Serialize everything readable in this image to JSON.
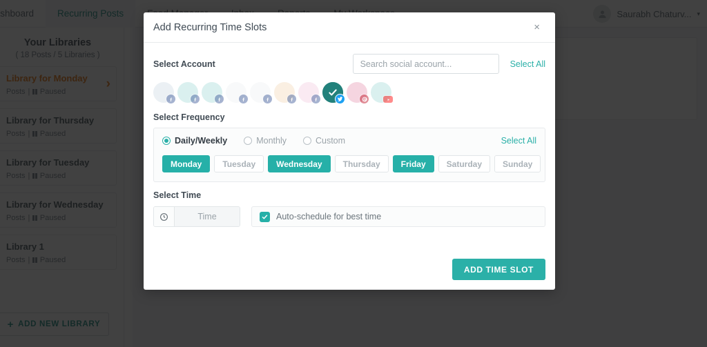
{
  "topnav": {
    "items": [
      {
        "label": "Dashboard",
        "active": false
      },
      {
        "label": "Recurring Posts",
        "active": true
      },
      {
        "label": "Feed Manager",
        "active": false
      },
      {
        "label": "Inbox",
        "active": false
      },
      {
        "label": "Reports",
        "active": false
      },
      {
        "label": "My Workspace",
        "active": false,
        "caret": "▾"
      }
    ],
    "user": {
      "name": "Saurabh Chaturv...",
      "caret": "▾",
      "avatar_icon": "user-avatar-icon"
    }
  },
  "sidebar": {
    "title": "Your Libraries",
    "subtitle": "( 18 Posts / 5 Libraries )",
    "libraries": [
      {
        "name": "Library for Monday",
        "meta": "Posts",
        "status": "Paused",
        "highlight": true
      },
      {
        "name": "Library for Thursday",
        "meta": "Posts",
        "status": "Paused",
        "highlight": false
      },
      {
        "name": "Library for Tuesday",
        "meta": "Posts",
        "status": "Paused",
        "highlight": false
      },
      {
        "name": "Library for Wednesday",
        "meta": "Posts",
        "status": "Paused",
        "highlight": false
      },
      {
        "name": "Library 1",
        "meta": "Posts",
        "status": "Paused",
        "highlight": false
      }
    ],
    "add_library_label": "ADD NEW LIBRARY",
    "add_library_plus": "+"
  },
  "modal": {
    "title": "Add Recurring Time Slots",
    "close_icon": "×",
    "account": {
      "label": "Select Account",
      "search_placeholder": "Search social account...",
      "search_value": "",
      "select_all": "Select All",
      "accounts": [
        {
          "network": "facebook",
          "selected": false,
          "color": "#cfdce4"
        },
        {
          "network": "facebook",
          "selected": false,
          "color": "#a8dcd8"
        },
        {
          "network": "facebook",
          "selected": false,
          "color": "#a8dcd8"
        },
        {
          "network": "facebook",
          "selected": false,
          "color": "#eef1f2"
        },
        {
          "network": "facebook",
          "selected": false,
          "color": "#eef1f2"
        },
        {
          "network": "facebook",
          "selected": false,
          "color": "#f4d9b9"
        },
        {
          "network": "facebook",
          "selected": false,
          "color": "#f3cde0"
        },
        {
          "network": "twitter",
          "selected": true,
          "color": "#2e7d76"
        },
        {
          "network": "pinterest",
          "selected": false,
          "color": "#e89ab4"
        },
        {
          "network": "youtube",
          "selected": false,
          "color": "#a8dcd8"
        }
      ]
    },
    "frequency": {
      "label": "Select Frequency",
      "options": [
        {
          "label": "Daily/Weekly",
          "selected": true
        },
        {
          "label": "Monthly",
          "selected": false
        },
        {
          "label": "Custom",
          "selected": false
        }
      ],
      "select_all": "Select All",
      "days": [
        {
          "label": "Monday",
          "selected": true
        },
        {
          "label": "Tuesday",
          "selected": false
        },
        {
          "label": "Wednesday",
          "selected": true
        },
        {
          "label": "Thursday",
          "selected": false
        },
        {
          "label": "Friday",
          "selected": true
        },
        {
          "label": "Saturday",
          "selected": false
        },
        {
          "label": "Sunday",
          "selected": false
        }
      ]
    },
    "time": {
      "label": "Select Time",
      "clock_icon": "clock-icon",
      "time_placeholder": "Time",
      "time_value": "",
      "auto_schedule_label": "Auto-schedule for best time",
      "auto_schedule_checked": true
    },
    "submit_label": "ADD TIME SLOT"
  },
  "colors": {
    "accent_teal": "#2bb0a8",
    "day_selected": "#26b0a8",
    "highlight_orange": "#e8730d",
    "nav_active": "#1d8a80"
  }
}
